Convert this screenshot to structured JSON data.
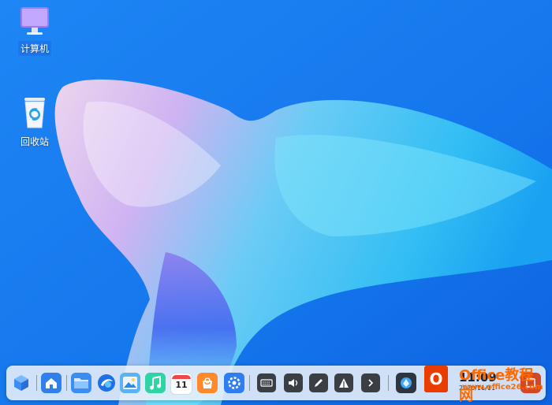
{
  "desktop": {
    "icons": [
      {
        "label": "计算机",
        "icon": "computer-icon"
      },
      {
        "label": "回收站",
        "icon": "trash-icon"
      }
    ]
  },
  "dock": {
    "apps": [
      {
        "name": "launcher",
        "icon": "launcher-cube-icon"
      },
      {
        "name": "home",
        "icon": "home-icon"
      },
      {
        "name": "file-manager",
        "icon": "folder-icon"
      },
      {
        "name": "browser",
        "icon": "browser-icon"
      },
      {
        "name": "image-viewer",
        "icon": "image-icon"
      },
      {
        "name": "music",
        "icon": "music-icon"
      },
      {
        "name": "calendar",
        "icon": "calendar-icon",
        "day": "11"
      },
      {
        "name": "app-store",
        "icon": "store-bag-icon"
      },
      {
        "name": "settings",
        "icon": "gear-icon"
      }
    ],
    "tray": [
      {
        "name": "keyboard",
        "icon": "keyboard-icon"
      },
      {
        "name": "volume",
        "icon": "volume-icon"
      },
      {
        "name": "edit",
        "icon": "pen-icon"
      },
      {
        "name": "network",
        "icon": "network-icon"
      },
      {
        "name": "expand",
        "icon": "chevron-right-icon"
      }
    ],
    "clock": {
      "time": "11:09",
      "date": "2020/11/11"
    }
  },
  "watermark": {
    "logo": "O",
    "line1": "Office教程网",
    "line2": "www.office26.com"
  },
  "colors": {
    "background": "#1a7cf0",
    "dock": "#ebf0f8",
    "tray": "#3a3f46"
  }
}
